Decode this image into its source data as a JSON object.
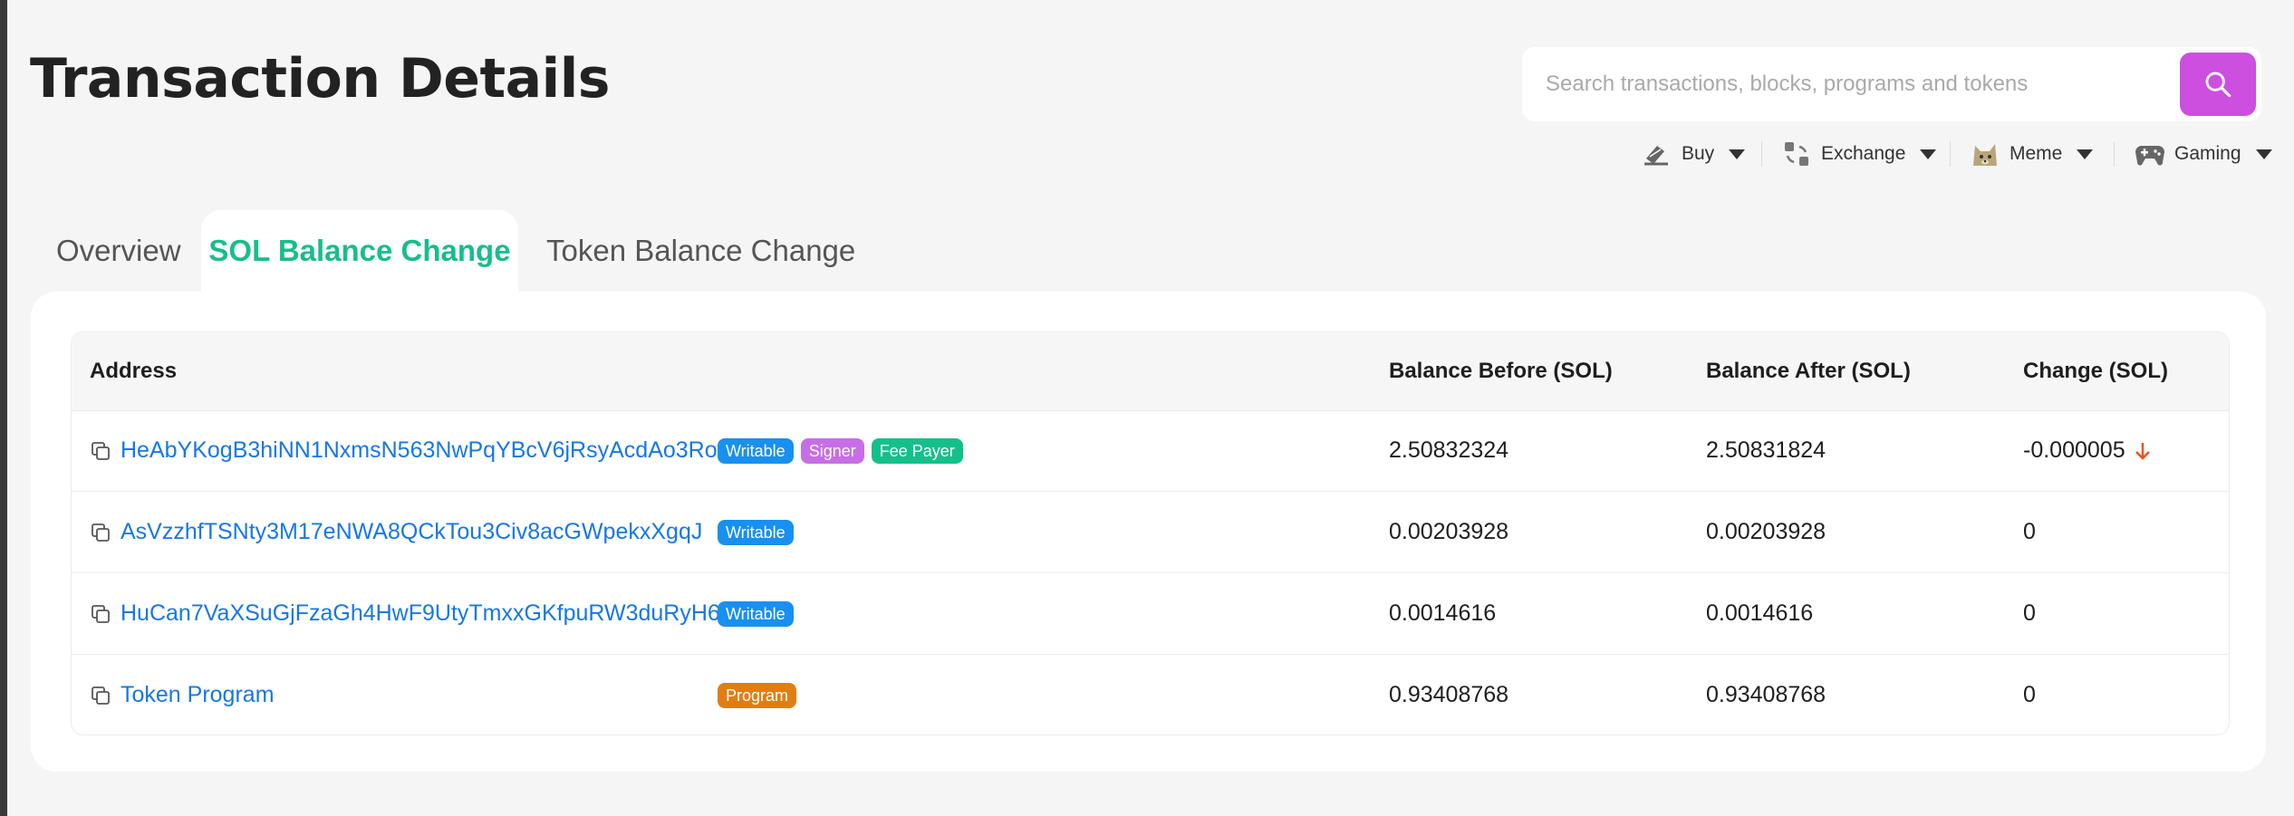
{
  "page": {
    "title": "Transaction Details"
  },
  "search": {
    "placeholder": "Search transactions, blocks, programs and tokens"
  },
  "categories": [
    {
      "label": "Buy",
      "icon": "buy-icon"
    },
    {
      "label": "Exchange",
      "icon": "exchange-icon"
    },
    {
      "label": "Meme",
      "icon": "meme-doge-icon"
    },
    {
      "label": "Gaming",
      "icon": "gamepad-icon"
    }
  ],
  "tabs": [
    {
      "label": "Overview",
      "active": false
    },
    {
      "label": "SOL Balance Change",
      "active": true
    },
    {
      "label": "Token Balance Change",
      "active": false
    }
  ],
  "table": {
    "headers": {
      "address": "Address",
      "before": "Balance Before (SOL)",
      "after": "Balance After (SOL)",
      "change": "Change (SOL)"
    },
    "rows": [
      {
        "address": "HeAbYKogB3hiNN1NxmsN563NwPqYBcV6jRsyAcdAo3Ro",
        "badges": [
          "Writable",
          "Signer",
          "Fee Payer"
        ],
        "before": "2.50832324",
        "after": "2.50831824",
        "change": "-0.000005",
        "change_direction": "down"
      },
      {
        "address": "AsVzzhfTSNty3M17eNWA8QCkTou3Civ8acGWpekxXgqJ",
        "badges": [
          "Writable"
        ],
        "before": "0.00203928",
        "after": "0.00203928",
        "change": "0"
      },
      {
        "address": "HuCan7VaXSuGjFzaGh4HwF9UtyTmxxGKfpuRW3duRyH6",
        "badges": [
          "Writable"
        ],
        "before": "0.0014616",
        "after": "0.0014616",
        "change": "0"
      },
      {
        "address": "Token Program",
        "badges": [
          "Program"
        ],
        "before": "0.93408768",
        "after": "0.93408768",
        "change": "0"
      }
    ]
  },
  "colors": {
    "accent_purple": "#cc4fe0",
    "active_tab_green": "#19bd8c",
    "link_blue": "#1677e6",
    "badge_writable": "#1890f0",
    "badge_signer": "#c76ee6",
    "badge_fee_payer": "#14c08a",
    "badge_program": "#e07e12",
    "negative_change": "#f0521c"
  }
}
